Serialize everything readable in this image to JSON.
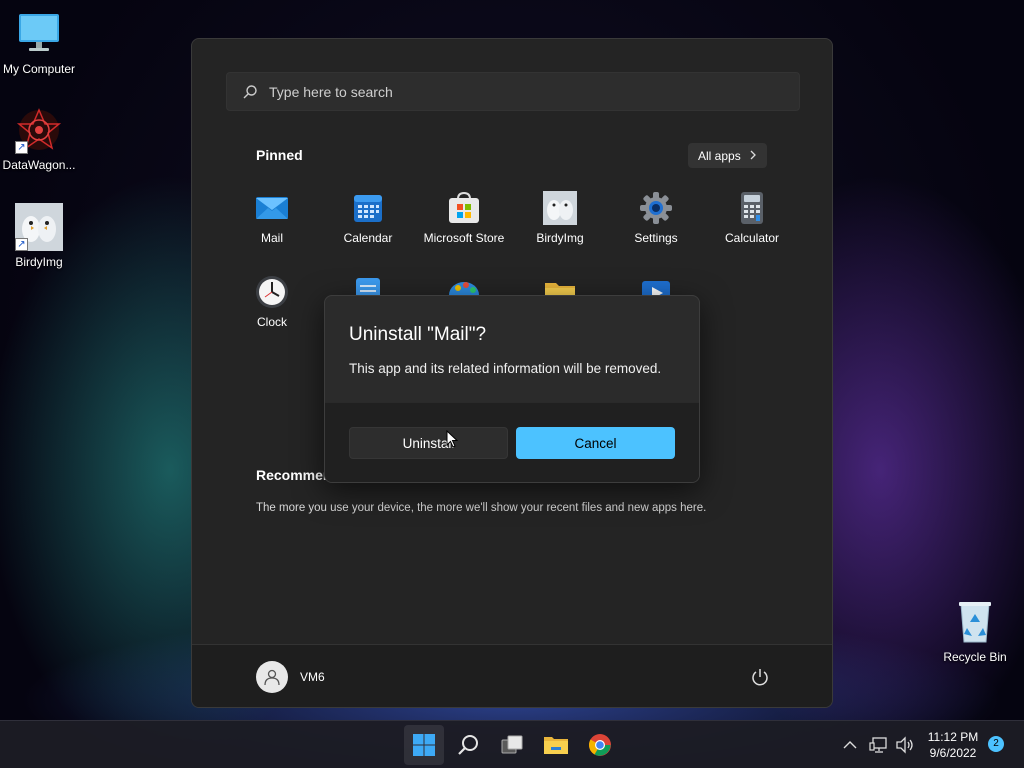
{
  "desktop": {
    "icons": [
      {
        "label": "My Computer",
        "icon": "monitor-icon"
      },
      {
        "label": "DataWagon...",
        "icon": "datawagon-icon"
      },
      {
        "label": "BirdyImg",
        "icon": "birdyimg-icon"
      },
      {
        "label": "Recycle Bin",
        "icon": "recycle-bin-icon"
      }
    ]
  },
  "start_menu": {
    "search_placeholder": "Type here to search",
    "pinned_title": "Pinned",
    "all_apps_label": "All apps",
    "pinned_apps": [
      {
        "label": "Mail",
        "icon": "mail-icon"
      },
      {
        "label": "Calendar",
        "icon": "calendar-icon"
      },
      {
        "label": "Microsoft Store",
        "icon": "store-icon"
      },
      {
        "label": "BirdyImg",
        "icon": "birdyimg-icon"
      },
      {
        "label": "Settings",
        "icon": "gear-icon"
      },
      {
        "label": "Calculator",
        "icon": "calculator-icon"
      },
      {
        "label": "Clock",
        "icon": "clock-icon"
      },
      {
        "label": "",
        "icon": "notepad-icon"
      },
      {
        "label": "",
        "icon": "paint-icon"
      },
      {
        "label": "",
        "icon": "folder-icon"
      },
      {
        "label": "",
        "icon": "media-player-icon"
      }
    ],
    "recommended_title": "Recommended",
    "recommended_text": "The more you use your device, the more we'll show your recent files and new apps here.",
    "user_name": "VM6"
  },
  "dialog": {
    "title": "Uninstall \"Mail\"?",
    "body": "This app and its related information will be removed.",
    "uninstall_label": "Uninstall",
    "cancel_label": "Cancel"
  },
  "taskbar": {
    "items": [
      "start-icon",
      "search-icon",
      "task-view-icon",
      "file-explorer-icon",
      "chrome-icon"
    ],
    "time": "11:12 PM",
    "date": "9/6/2022",
    "notification_count": "2"
  },
  "colors": {
    "accent": "#4cc2ff",
    "menu_bg": "#242424",
    "dialog_bg": "#2b2b2b"
  }
}
